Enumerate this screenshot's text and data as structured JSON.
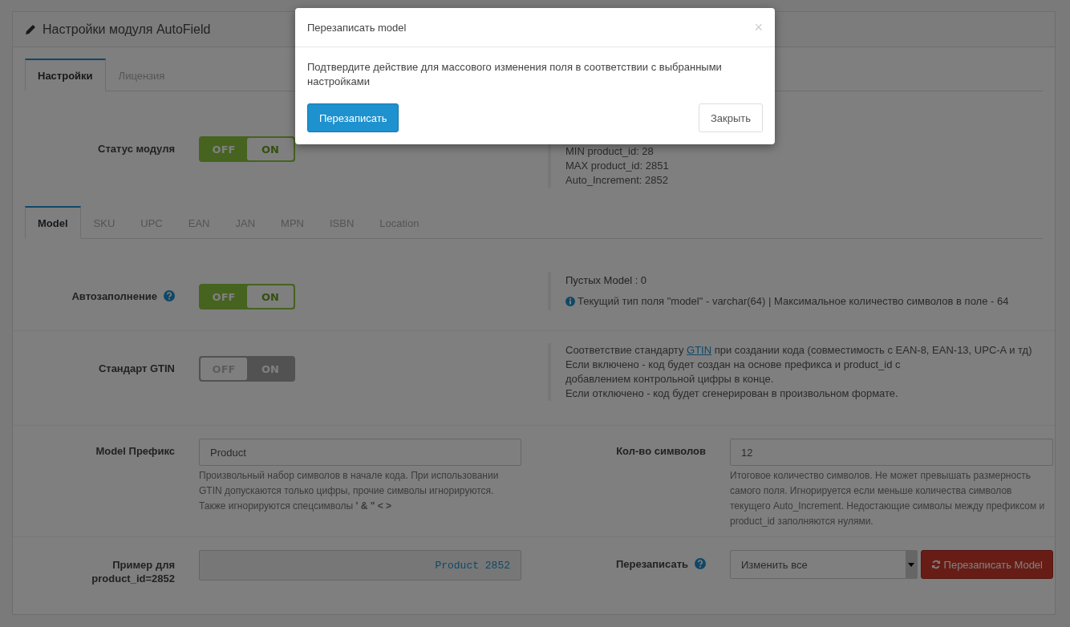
{
  "panel": {
    "title": "Настройки модуля AutoField"
  },
  "main_tabs": [
    {
      "label": "Настройки",
      "selected": true
    },
    {
      "label": "Лицензия",
      "selected": false
    }
  ],
  "module_status": {
    "label": "Статус модуля",
    "on": true,
    "off_text": "OFF",
    "on_text": "ON"
  },
  "stats": [
    "MIN product_id: 28",
    "MAX product_id: 2851",
    "Auto_Increment: 2852"
  ],
  "field_tabs": [
    {
      "label": "Model",
      "selected": true
    },
    {
      "label": "SKU",
      "selected": false
    },
    {
      "label": "UPC",
      "selected": false
    },
    {
      "label": "EAN",
      "selected": false
    },
    {
      "label": "JAN",
      "selected": false
    },
    {
      "label": "MPN",
      "selected": false
    },
    {
      "label": "ISBN",
      "selected": false
    },
    {
      "label": "Location",
      "selected": false
    }
  ],
  "autofill": {
    "label": "Автозаполнение",
    "on": true,
    "off_text": "OFF",
    "on_text": "ON",
    "empty_count": "Пустых Model : 0",
    "field_info": "Текущий тип поля \"model\" - varchar(64) | Максимальное количество символов в поле - 64"
  },
  "gtin": {
    "label": "Стандарт GTIN",
    "on": false,
    "off_text": "OFF",
    "on_text": "ON",
    "desc_before": "Соответствие стандарту ",
    "desc_link": "GTIN",
    "desc_after": " при создании кода (совместимость с EAN-8, EAN-13, UPC-A и тд)",
    "desc_lines": [
      "Если включено - код будет создан на основе префикса и product_id с добавлением контрольной цифры в конце.",
      "Если отключено - код будет сгенерирован в произвольном формате."
    ]
  },
  "prefix": {
    "label": "Model Префикс",
    "value": "Product",
    "help": "Произвольный набор символов в начале кода. При использовании GTIN допускаются только цифры, прочие символы игнорируются. Также игнорируются спецсимволы **' & \" < >**"
  },
  "length": {
    "label": "Кол-во символов",
    "value": "12",
    "help": "Итоговое количество символов. Не может превышать размерность самого поля. Игнорируется если меньше количества символов текущего Auto_Increment. Недостающие символы между префиксом и product_id заполняются нулями."
  },
  "example": {
    "label": "Пример для product_id=2852",
    "value": "Product 2852"
  },
  "overwrite": {
    "label": "Перезаписать",
    "select_value": "Изменить все",
    "button": "Перезаписать Model"
  },
  "modal": {
    "title": "Перезаписать model",
    "close_icon": "×",
    "message": "Подтвердите действие для массового изменения поля в соответствии с выбранными настройками",
    "confirm": "Перезаписать",
    "cancel": "Закрыть"
  }
}
